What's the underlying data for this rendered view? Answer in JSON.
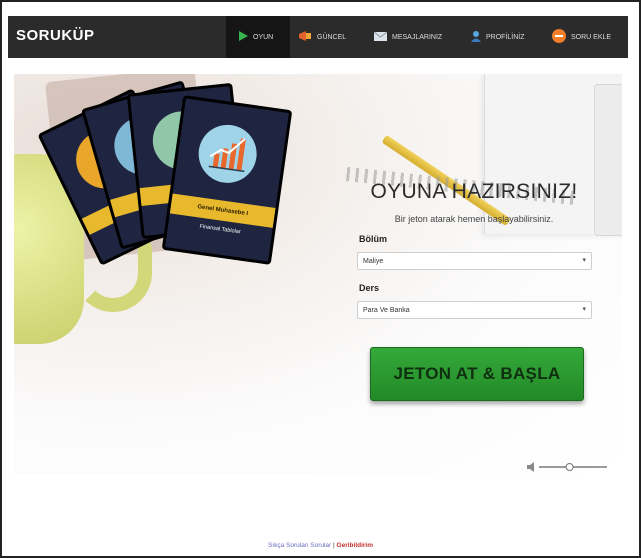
{
  "app": {
    "logo": "SORUKÜP"
  },
  "nav": {
    "items": [
      {
        "label": "OYUN",
        "icon": "play-icon",
        "active": true
      },
      {
        "label": "GÜNCEL",
        "icon": "megaphone-icon"
      },
      {
        "label": "MESAJLARINIZ",
        "icon": "envelope-icon"
      },
      {
        "label": "PROFİLİNİZ",
        "icon": "user-icon"
      },
      {
        "label": "SORU EKLE",
        "icon": "add-question-icon"
      }
    ]
  },
  "cards": {
    "front_title": "Genel Muhasebe I",
    "front_subtitle": "Finansal Tablolar"
  },
  "game": {
    "title": "OYUNA HAZIRSINIZ!",
    "subtitle": "Bir jeton atarak hemen başlayabilirsiniz.",
    "section_label": "Bölüm",
    "section_value": "Maliye",
    "course_label": "Ders",
    "course_value": "Para Ve Banka",
    "start_button": "JETON AT & BAŞLA"
  },
  "volume": {
    "icon": "speaker-icon",
    "level": 0.45
  },
  "footer": {
    "faq": "Sıkça Sorulan Sorular",
    "separator": "|",
    "feedback": "Geribildirim"
  },
  "colors": {
    "nav_bg": "#2b2b2b",
    "accent_green": "#2e9d33",
    "feedback_red": "#c0322b"
  }
}
